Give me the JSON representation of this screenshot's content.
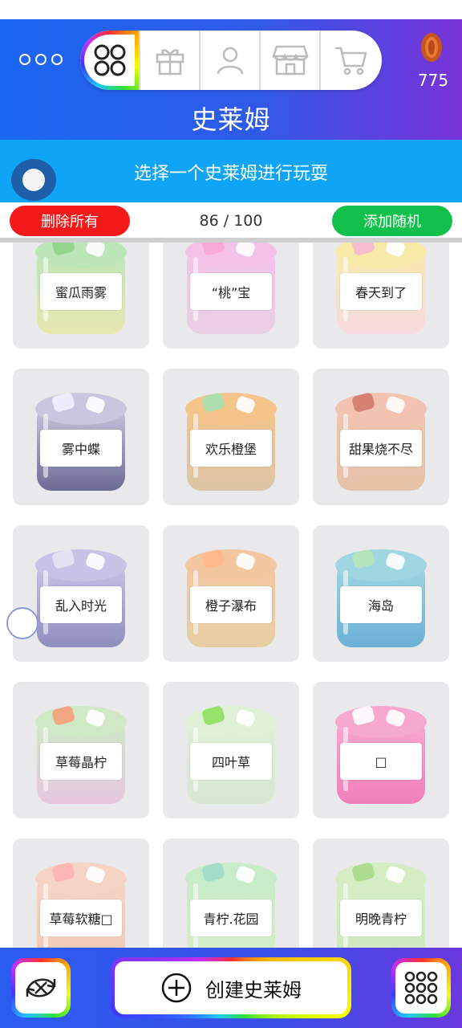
{
  "header": {
    "title": "史莱姆",
    "coins": "775",
    "nav": [
      "slime-grid-icon",
      "gift-icon",
      "person-icon",
      "shop-icon",
      "cart-icon"
    ],
    "accent": "#1a67f2"
  },
  "band": {
    "text": "选择一个史莱姆进行玩耍"
  },
  "actions": {
    "delete_label": "删除所有",
    "count": "86 / 100",
    "random_label": "添加随机"
  },
  "slimes": [
    {
      "name": "蜜瓜雨雾",
      "body": "#e6e7b0",
      "top": "#bde6b8",
      "accent": "#8fd18a"
    },
    {
      "name": "“桃”宝",
      "body": "#ead0e6",
      "top": "#f4c2e8",
      "accent": "#f8a6d8"
    },
    {
      "name": "春天到了",
      "body": "#f6d9e2",
      "top": "#f7e9a8",
      "accent": "#f5b8cf"
    },
    {
      "name": "雾中蝶",
      "body": "#6c6a94",
      "top": "#c7c7df",
      "accent": "#f0f0ff"
    },
    {
      "name": "欢乐橙堡",
      "body": "#dcc4a8",
      "top": "#f4c48a",
      "accent": "#a8e0b0"
    },
    {
      "name": "甜果烧不尽",
      "body": "#e6c2a8",
      "top": "#f1c3b0",
      "accent": "#d27a6a"
    },
    {
      "name": "乱入时光",
      "body": "#8f8fbf",
      "top": "#c7c2e6",
      "accent": "#e6e6f5"
    },
    {
      "name": "橙子瀑布",
      "body": "#e7cfa5",
      "top": "#f3c6a0",
      "accent": "#ffb88a"
    },
    {
      "name": "海岛",
      "body": "#6bb0d6",
      "top": "#9fd6e1",
      "accent": "#b6e6b8"
    },
    {
      "name": "草莓晶柠",
      "body": "#e7c7df",
      "top": "#cfe8c6",
      "accent": "#f5a07a"
    },
    {
      "name": "四叶草",
      "body": "#d7e6d1",
      "top": "#dff0d7",
      "accent": "#8ee060"
    },
    {
      "name": "□",
      "body": "#f17fb9",
      "top": "#f6a8cf",
      "accent": "#ffffff"
    },
    {
      "name": "草莓软糖□",
      "body": "#f0c9b8",
      "top": "#f5d4c6",
      "accent": "#ffb3b3"
    },
    {
      "name": "青柠.花园",
      "body": "#d8edc8",
      "top": "#c8ebc9",
      "accent": "#9fdcc8"
    },
    {
      "name": "明晚青柠",
      "body": "#cfe6c0",
      "top": "#d6edc4",
      "accent": "#a8d98c"
    }
  ],
  "bottom": {
    "create_label": "创建史莱姆",
    "left_icon": "shuffle-icon",
    "right_icon": "slime-grid-icon"
  }
}
